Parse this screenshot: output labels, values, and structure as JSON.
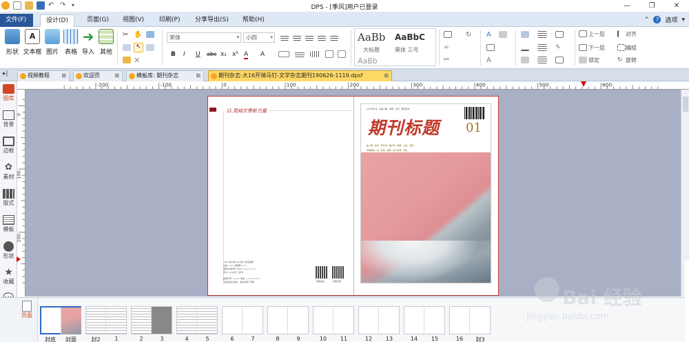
{
  "window": {
    "title": "DPS - [季风]用户已登录",
    "controls": [
      "—",
      "❐",
      "✕"
    ]
  },
  "menu": {
    "tabs": [
      "文件(F)",
      "设计(D)",
      "页面(G)",
      "视图(V)",
      "印刷(P)",
      "分享导出(S)",
      "帮助(H)"
    ],
    "active": "设计(D)",
    "right_options": "选项"
  },
  "ribbon": {
    "big_buttons": [
      "形状",
      "文本框",
      "图片",
      "表格",
      "导入",
      "其他"
    ],
    "font_name": "宋体",
    "font_size": "小四",
    "format_buttons": [
      "B",
      "I",
      "U",
      "abc",
      "x₂",
      "x²",
      "A",
      "A"
    ],
    "styles": {
      "style1_preview": "AaBb",
      "style1_label": "大标题",
      "style2_preview": "AaBbC",
      "style2_label": "黑体 三号",
      "style3_preview": "AaBb"
    },
    "arrange": {
      "up_layer": "上一层",
      "down_layer": "下一层",
      "lock": "锁定",
      "align": "对齐",
      "group": "编组",
      "rotate": "旋转"
    }
  },
  "doc_tabs": [
    {
      "label": "视频教程",
      "active": false
    },
    {
      "label": "欢迎页",
      "active": false
    },
    {
      "label": "模板库: 期刊杂志",
      "active": false
    },
    {
      "label": "期刊杂志-大16开骑马钉-文学杂志期刊190626-1119.dpsf",
      "active": true
    }
  ],
  "left_toolbar": [
    {
      "label": "图库",
      "icon": "gallery-icon"
    },
    {
      "label": "背景",
      "icon": "background-icon"
    },
    {
      "label": "边框",
      "icon": "border-icon"
    },
    {
      "label": "素材",
      "icon": "material-icon"
    },
    {
      "label": "版式",
      "icon": "layout-icon"
    },
    {
      "label": "模板",
      "icon": "template-icon"
    },
    {
      "label": "形状",
      "icon": "shape-icon"
    },
    {
      "label": "收藏",
      "icon": "star-icon"
    },
    {
      "label": "客服",
      "icon": "chat-icon"
    }
  ],
  "ruler": {
    "h_labels": [
      "-200",
      "-100",
      "0",
      "100",
      "200",
      "300",
      "400",
      "500",
      "600"
    ],
    "v_labels": [
      "0",
      "100",
      "200"
    ]
  },
  "document": {
    "back_page_header": "Ω.見綺文學新力量",
    "back_page_info": [
      "2019 第×期 2019年 1月总第期",
      "主编: ××× 编辑部 ×××",
      "国际标准刊号 ISSN ××××-××××",
      "定价: 10.00元（全年）",
      "邮发代号: ×××× 电话: ××××××××",
      "某某出版社出版 · 某某印刷厂印刷"
    ],
    "qr_captions": [
      "扫码关注",
      "扫码订阅"
    ],
    "cover_title": "期刊标题",
    "cover_issue": "01",
    "cover_topline": "2019年1月 · 总第×期 · 本期 · 文学 · 期刊杂志",
    "cover_line1": "第一辑 · 春日 · 风与海 · 散文诗 · 随笔 · 小说 · 名家",
    "cover_line2": "特别策划 · 海 · 名家 · 随笔 · 新人新作 · 评论"
  },
  "thumbnails": {
    "page_label": "页面",
    "items": [
      {
        "left": "封底",
        "right": "封面",
        "active": true
      },
      {
        "left": "封2",
        "right": "1",
        "active": false
      },
      {
        "left": "2",
        "right": "3",
        "active": false
      },
      {
        "left": "4",
        "right": "5",
        "active": false
      },
      {
        "left": "6",
        "right": "7",
        "active": false
      },
      {
        "left": "8",
        "right": "9",
        "active": false
      },
      {
        "left": "10",
        "right": "11",
        "active": false
      },
      {
        "left": "12",
        "right": "13",
        "active": false
      },
      {
        "left": "14",
        "right": "15",
        "active": false
      },
      {
        "left": "16",
        "right": "封3",
        "active": false
      }
    ]
  },
  "watermark": {
    "text": "Bai 经验",
    "url": "jingyan.baidu.com"
  }
}
